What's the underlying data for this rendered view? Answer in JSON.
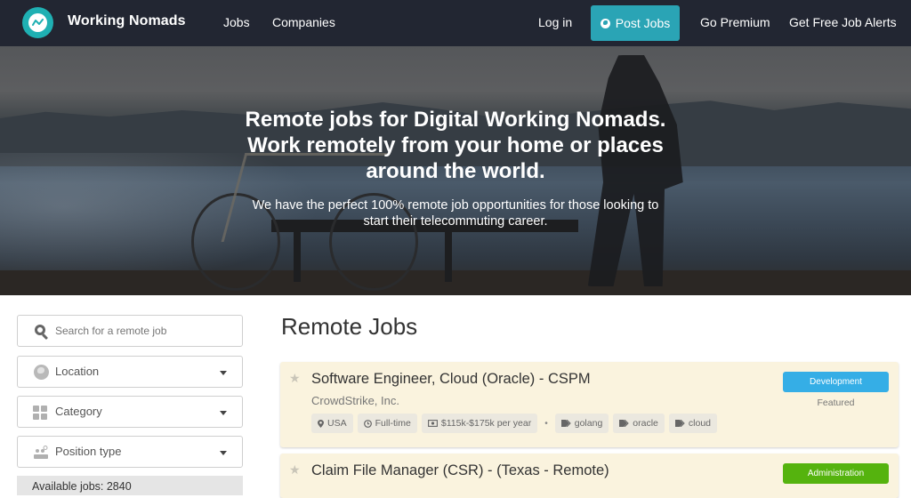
{
  "navbar": {
    "brand": "Working Nomads",
    "links": {
      "jobs": "Jobs",
      "companies": "Companies",
      "login": "Log in",
      "post_jobs": "Post Jobs",
      "go_premium": "Go Premium",
      "job_alerts": "Get Free Job Alerts"
    },
    "colors": {
      "background": "#222632",
      "logo": "#1fb0b3",
      "post_jobs_button": "#2aa4b5"
    }
  },
  "hero": {
    "title_lines": [
      "Remote jobs for Digital Working Nomads.",
      "Work remotely from your home or places",
      "around the world."
    ],
    "subtitle_lines": [
      "We have the perfect 100% remote job opportunities for those looking to",
      "start their telecommuting career."
    ]
  },
  "sidebar": {
    "search": {
      "placeholder": "Search for a remote job",
      "value": ""
    },
    "filters": [
      {
        "label": "Location",
        "icon": "globe-icon"
      },
      {
        "label": "Category",
        "icon": "grid-icon"
      },
      {
        "label": "Position type",
        "icon": "position-type-icon"
      }
    ],
    "available_jobs": "Available jobs: 2840"
  },
  "main": {
    "title": "Remote Jobs",
    "jobs": [
      {
        "title": "Software Engineer, Cloud (Oracle) - CSPM",
        "company": "CrowdStrike, Inc.",
        "meta_tags": [
          {
            "icon": "map-pin-icon",
            "label": "USA"
          },
          {
            "icon": "clock-icon",
            "label": "Full-time"
          },
          {
            "icon": "money-icon",
            "label": "$115k-$175k per year"
          }
        ],
        "skill_tags": [
          "golang",
          "oracle",
          "cloud"
        ],
        "category": "Development",
        "category_color": "#35aee6",
        "status": "Featured"
      },
      {
        "title": "Claim File Manager (CSR) - (Texas - Remote)",
        "category": "Administration",
        "category_color": "#55b30e"
      }
    ]
  }
}
